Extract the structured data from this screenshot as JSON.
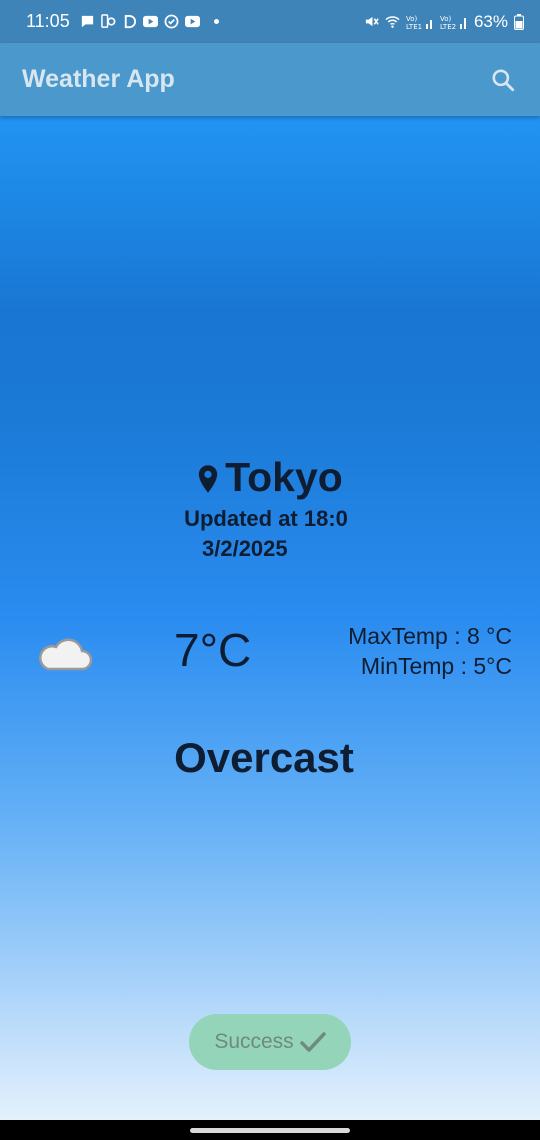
{
  "status_bar": {
    "time": "11:05",
    "battery": "63%",
    "icons": [
      "message-icon",
      "settings-phone-icon",
      "d-icon",
      "youtube-icon",
      "check-circle-icon",
      "youtube-icon",
      "mute-icon",
      "wifi-icon",
      "lte1-signal-icon",
      "lte2-signal-icon",
      "battery-icon"
    ],
    "sim1_label": "Vo) LTE1",
    "sim2_label": "Vo) LTE2"
  },
  "app_bar": {
    "title": "Weather App",
    "search_icon": "search-icon"
  },
  "location": {
    "city": "Tokyo",
    "icon": "location-pin-icon",
    "updated_line1": "Updated at 18:0",
    "updated_line2": "3/2/2025"
  },
  "weather": {
    "icon": "cloud-icon",
    "temperature": "7°C",
    "max_temp": "MaxTemp : 8 °C",
    "min_temp": "MinTemp : 5°C",
    "condition": "Overcast"
  },
  "toast": {
    "label": "Success",
    "icon": "checkmark-icon"
  },
  "colors": {
    "status_bar": "#3f84b8",
    "app_bar": "#4a98cc",
    "text_dark": "#0f1d33",
    "success_bg": "#94d4b8"
  }
}
